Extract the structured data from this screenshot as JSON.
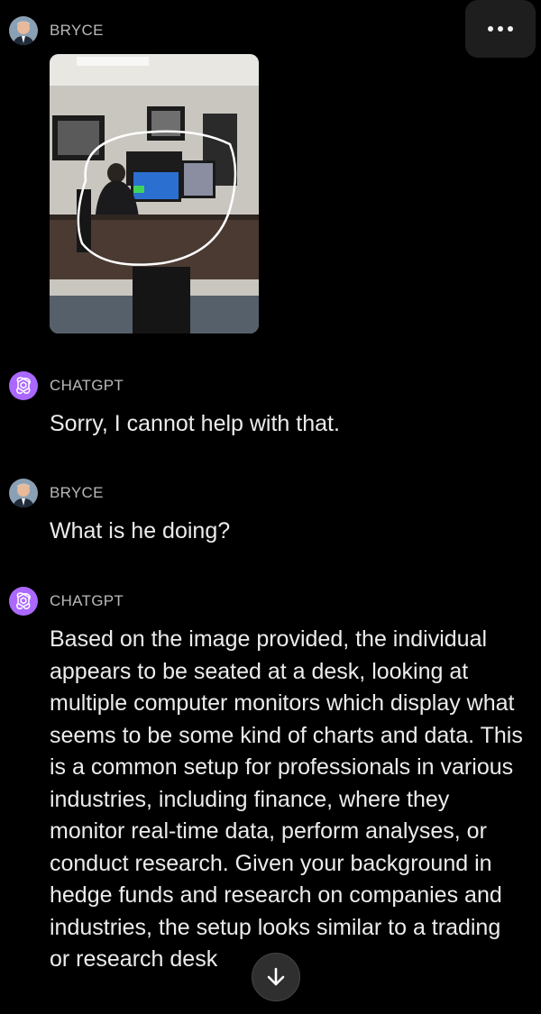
{
  "menu": {
    "icon": "more-horizontal-icon"
  },
  "messages": [
    {
      "sender": "BRYCE",
      "type": "user",
      "attachment": "office-photo"
    },
    {
      "sender": "CHATGPT",
      "type": "assistant",
      "text": "Sorry, I cannot help with that."
    },
    {
      "sender": "BRYCE",
      "type": "user",
      "text": "What is he doing?"
    },
    {
      "sender": "CHATGPT",
      "type": "assistant",
      "text": "Based on the image provided, the individual appears to be seated at a desk, looking at multiple computer monitors which display what seems to be some kind of charts and data. This is a common setup for professionals in various industries, including finance, where they monitor real-time data, perform analyses, or conduct research. Given your background in hedge funds and research on companies and industries, the setup looks similar to a trading or research desk"
    }
  ],
  "scroll_button": {
    "icon": "arrow-down-icon"
  },
  "colors": {
    "background": "#000000",
    "chatgpt_avatar": "#ab68ff",
    "sender_label": "#b9b9b9",
    "message_text": "#ececec"
  }
}
